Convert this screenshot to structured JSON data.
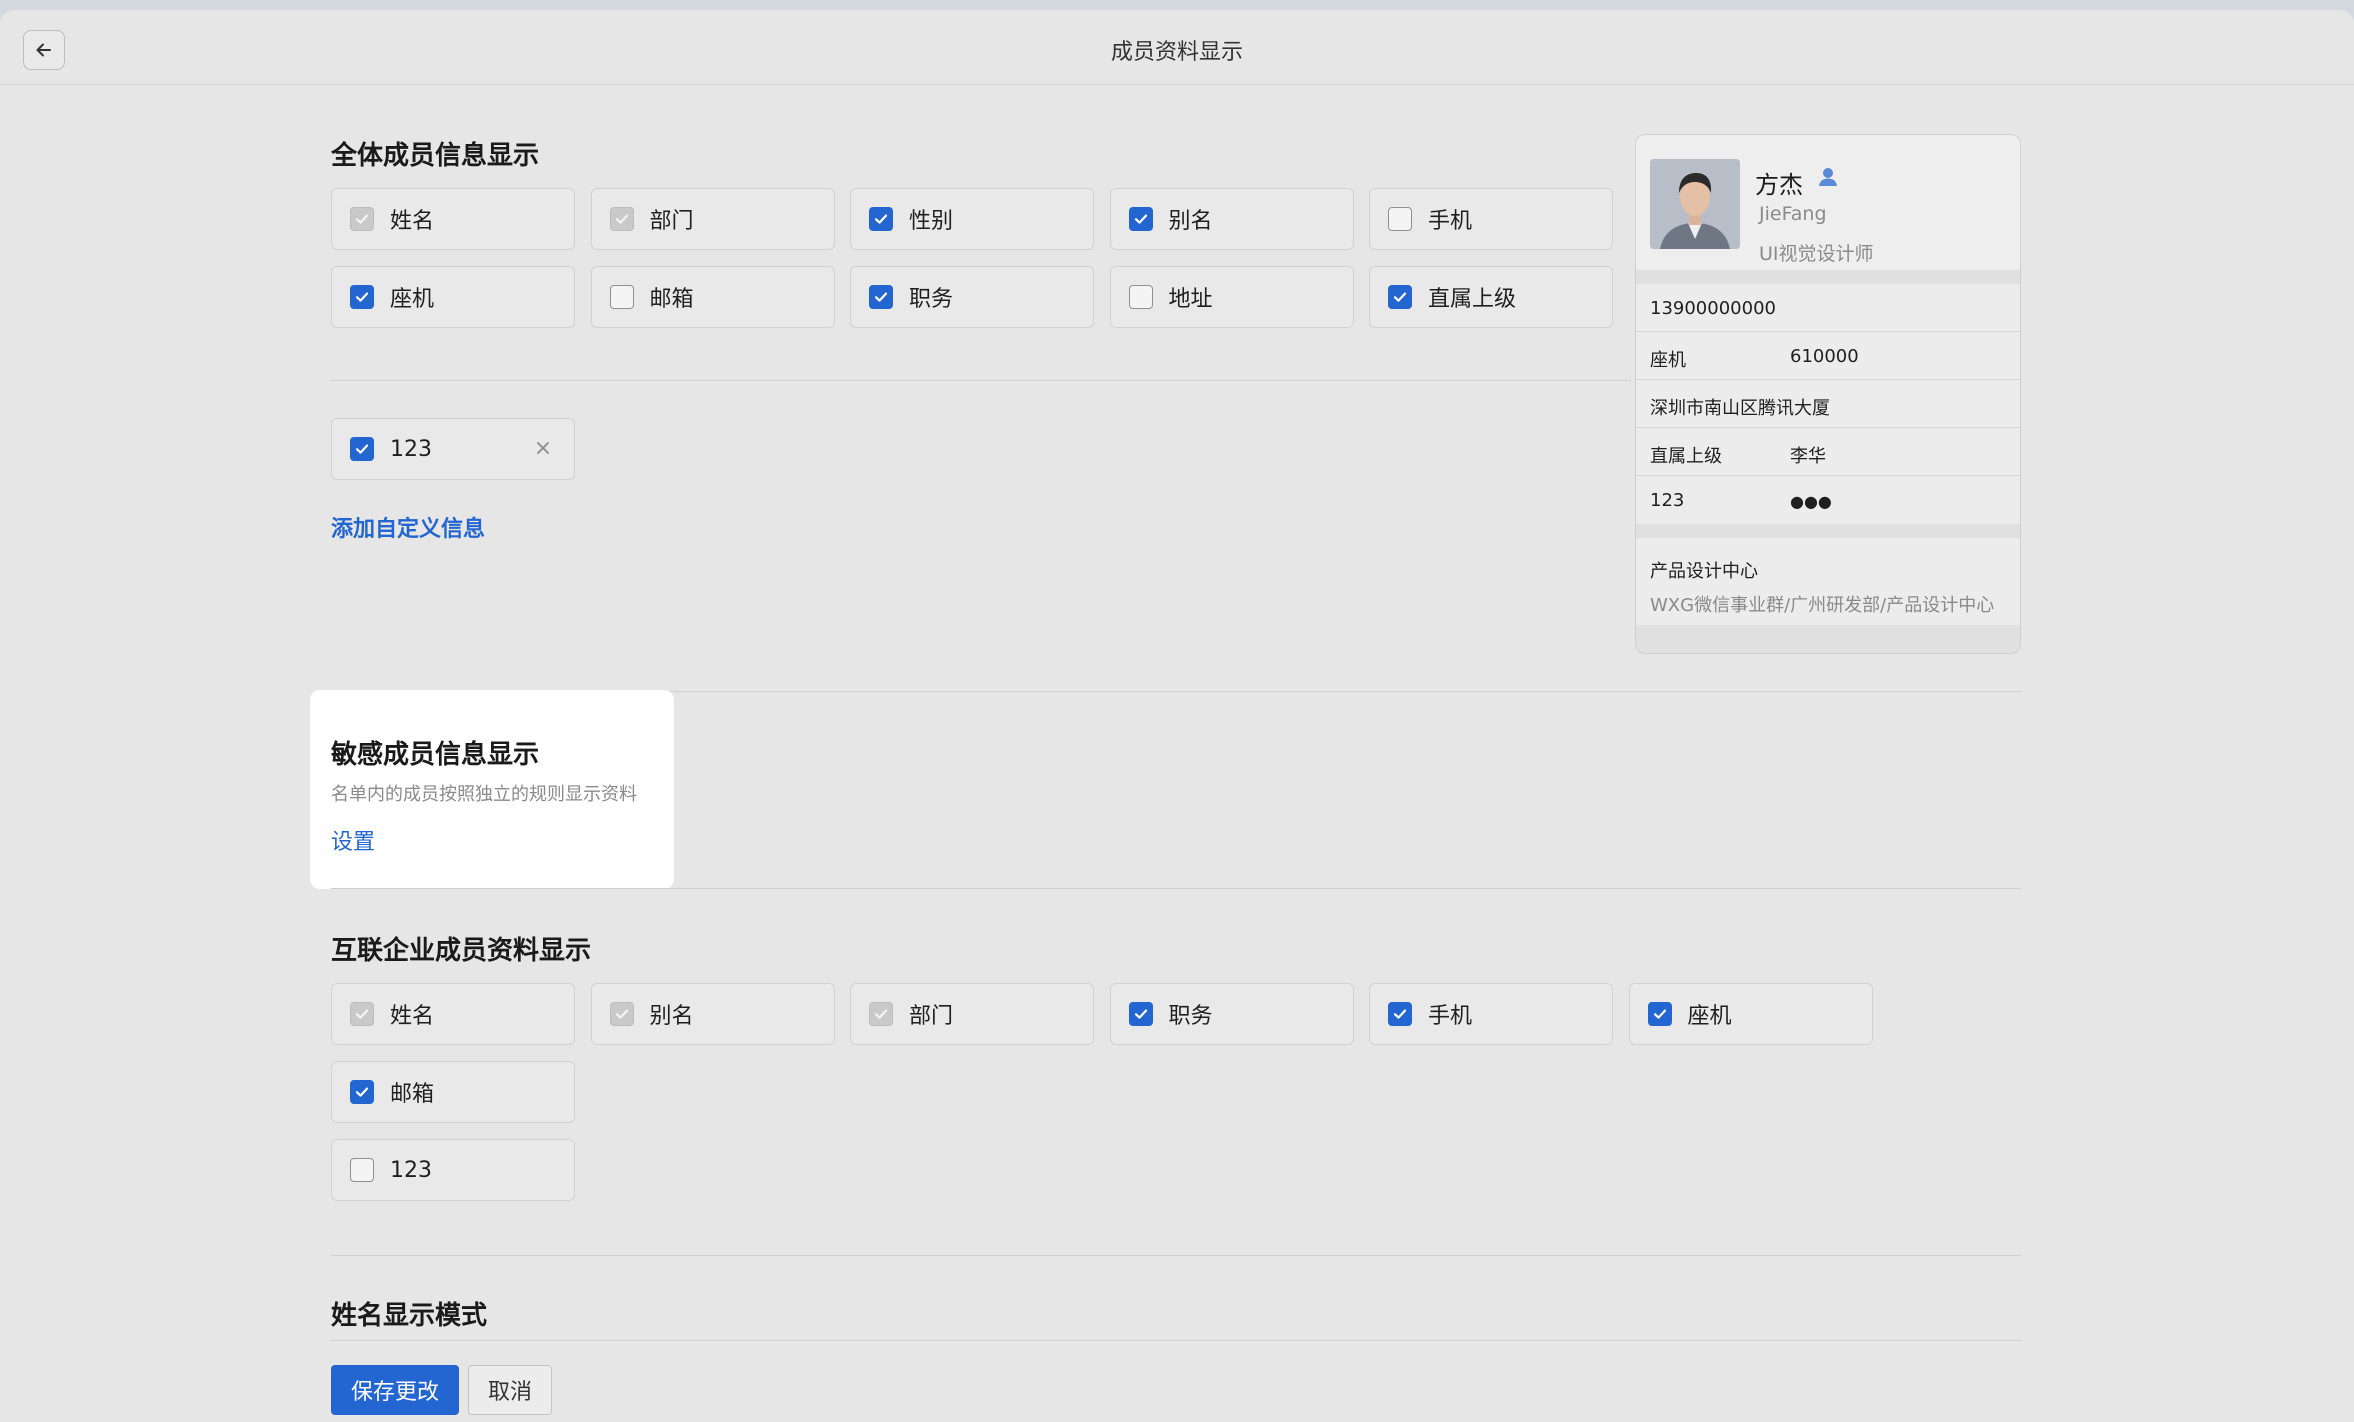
{
  "header": {
    "title": "成员资料显示"
  },
  "all_members": {
    "title": "全体成员信息显示",
    "fields": [
      {
        "label": "姓名",
        "state": "disabled"
      },
      {
        "label": "部门",
        "state": "disabled"
      },
      {
        "label": "性别",
        "state": "checked"
      },
      {
        "label": "别名",
        "state": "checked"
      },
      {
        "label": "手机",
        "state": "unchecked"
      },
      {
        "label": "座机",
        "state": "checked"
      },
      {
        "label": "邮箱",
        "state": "unchecked"
      },
      {
        "label": "职务",
        "state": "checked"
      },
      {
        "label": "地址",
        "state": "unchecked"
      },
      {
        "label": "直属上级",
        "state": "checked"
      }
    ],
    "custom_field": {
      "label": "123",
      "state": "checked"
    },
    "add_custom_label": "添加自定义信息"
  },
  "sensitive": {
    "title": "敏感成员信息显示",
    "description": "名单内的成员按照独立的规则显示资料",
    "setting_label": "设置"
  },
  "connected": {
    "title": "互联企业成员资料显示",
    "fields": [
      {
        "label": "姓名",
        "state": "disabled"
      },
      {
        "label": "别名",
        "state": "disabled"
      },
      {
        "label": "部门",
        "state": "disabled"
      },
      {
        "label": "职务",
        "state": "checked"
      },
      {
        "label": "手机",
        "state": "checked"
      },
      {
        "label": "座机",
        "state": "checked"
      },
      {
        "label": "邮箱",
        "state": "checked"
      },
      {
        "label": "123",
        "state": "unchecked"
      }
    ]
  },
  "name_mode": {
    "title": "姓名显示模式"
  },
  "actions": {
    "save_label": "保存更改",
    "cancel_label": "取消"
  },
  "card": {
    "name": "方杰",
    "alias": "JieFang",
    "job_title": "UI视觉设计师",
    "phone": "13900000000",
    "landline_key": "座机",
    "landline_value": "610000",
    "address": "深圳市南山区腾讯大厦",
    "manager_key": "直属上级",
    "manager_value": "李华",
    "custom_key": "123",
    "custom_value": "●●●",
    "org_name": "产品设计中心",
    "org_path": "WXG微信事业群/广州研发部/产品设计中心"
  },
  "colors": {
    "accent": "#2466d1",
    "window_bg": "#e6e6e6",
    "card_bg": "#ececec"
  }
}
